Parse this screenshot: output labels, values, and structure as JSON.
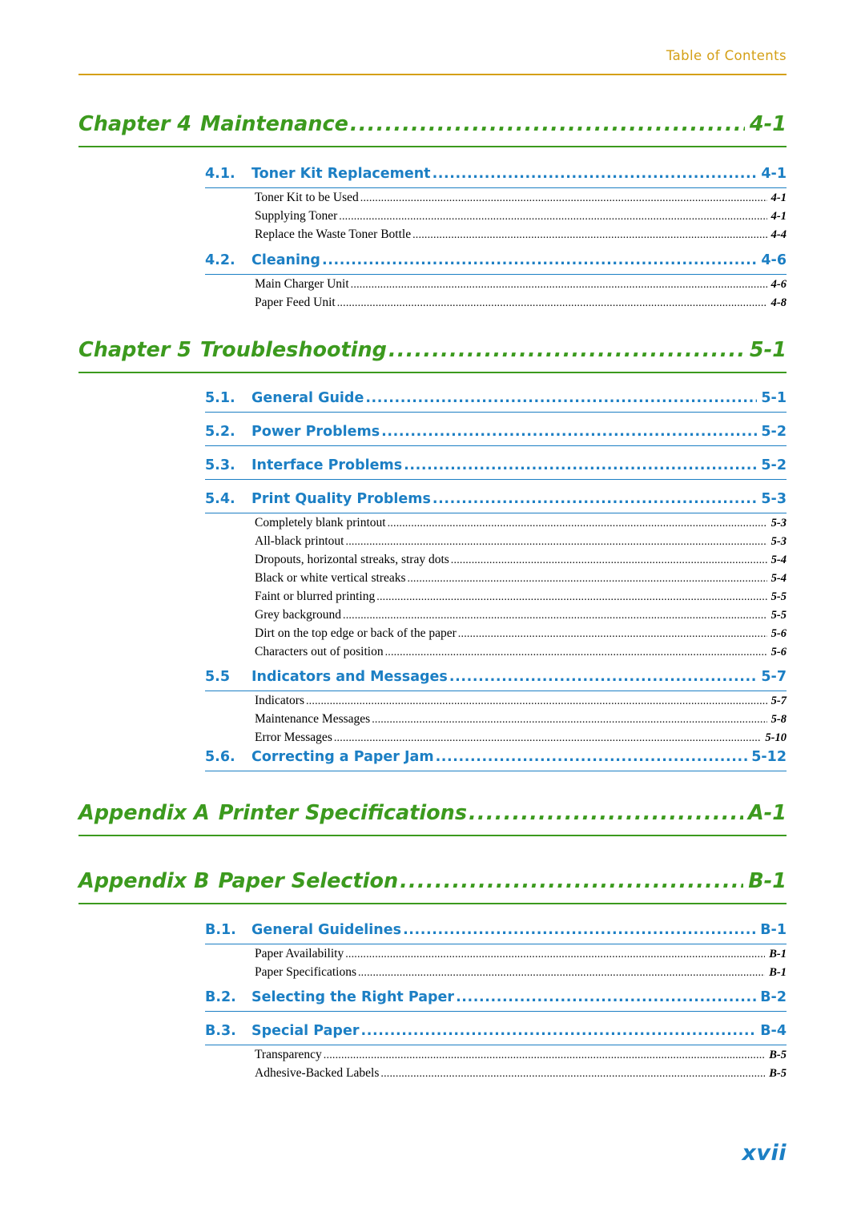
{
  "header": {
    "label": "Table of Contents",
    "rule_color": "#D4A017"
  },
  "colors": {
    "chapter": "#3C9A1E",
    "section": "#1C7FC4",
    "header": "#D4A017",
    "entry": "#000000"
  },
  "chapters": [
    {
      "num": "Chapter 4",
      "title": "Maintenance",
      "page": "4-1"
    },
    {
      "num": "Chapter 5",
      "title": "Troubleshooting",
      "page": "5-1"
    },
    {
      "num": "Appendix A",
      "title": "Printer Specifications",
      "page": "A-1"
    },
    {
      "num": "Appendix B",
      "title": "Paper Selection",
      "page": "B-1"
    }
  ],
  "sections": [
    {
      "num": "4.1.",
      "title": "Toner Kit Replacement",
      "page": "4-1"
    },
    {
      "num": "4.2.",
      "title": "Cleaning",
      "page": "4-6"
    },
    {
      "num": "5.1.",
      "title": "General Guide",
      "page": "5-1"
    },
    {
      "num": "5.2.",
      "title": "Power Problems",
      "page": "5-2"
    },
    {
      "num": "5.3.",
      "title": "Interface Problems",
      "page": "5-2"
    },
    {
      "num": "5.4.",
      "title": "Print Quality Problems",
      "page": "5-3"
    },
    {
      "num": "5.5",
      "title": "Indicators and Messages",
      "page": "5-7"
    },
    {
      "num": "5.6.",
      "title": "Correcting a Paper Jam",
      "page": "5-12"
    },
    {
      "num": "B.1.",
      "title": "General Guidelines",
      "page": "B-1"
    },
    {
      "num": "B.2.",
      "title": "Selecting the Right Paper",
      "page": "B-2"
    },
    {
      "num": "B.3.",
      "title": "Special Paper",
      "page": "B-4"
    }
  ],
  "entries": [
    {
      "title": "Toner Kit to be Used",
      "page": "4-1"
    },
    {
      "title": "Supplying Toner",
      "page": "4-1"
    },
    {
      "title": "Replace the Waste Toner Bottle",
      "page": "4-4"
    },
    {
      "title": "Main Charger Unit",
      "page": "4-6"
    },
    {
      "title": "Paper Feed Unit",
      "page": "4-8"
    },
    {
      "title": "Completely blank printout",
      "page": "5-3"
    },
    {
      "title": "All-black printout",
      "page": "5-3"
    },
    {
      "title": "Dropouts, horizontal streaks, stray dots",
      "page": "5-4"
    },
    {
      "title": "Black or white vertical streaks",
      "page": "5-4"
    },
    {
      "title": "Faint or blurred printing",
      "page": "5-5"
    },
    {
      "title": "Grey background",
      "page": "5-5"
    },
    {
      "title": "Dirt on the top edge or back of the paper",
      "page": "5-6"
    },
    {
      "title": "Characters out of position",
      "page": "5-6"
    },
    {
      "title": "Indicators",
      "page": "5-7"
    },
    {
      "title": "Maintenance Messages",
      "page": "5-8"
    },
    {
      "title": "Error Messages",
      "page": "5-10"
    },
    {
      "title": "Paper Availability",
      "page": "B-1"
    },
    {
      "title": "Paper Specifications",
      "page": "B-1"
    },
    {
      "title": "Transparency",
      "page": "B-5"
    },
    {
      "title": "Adhesive-Backed Labels",
      "page": "B-5"
    }
  ],
  "footer": {
    "page_number": "xvii"
  },
  "leader": {
    "dots": "........................................................................................................................................................................."
  }
}
